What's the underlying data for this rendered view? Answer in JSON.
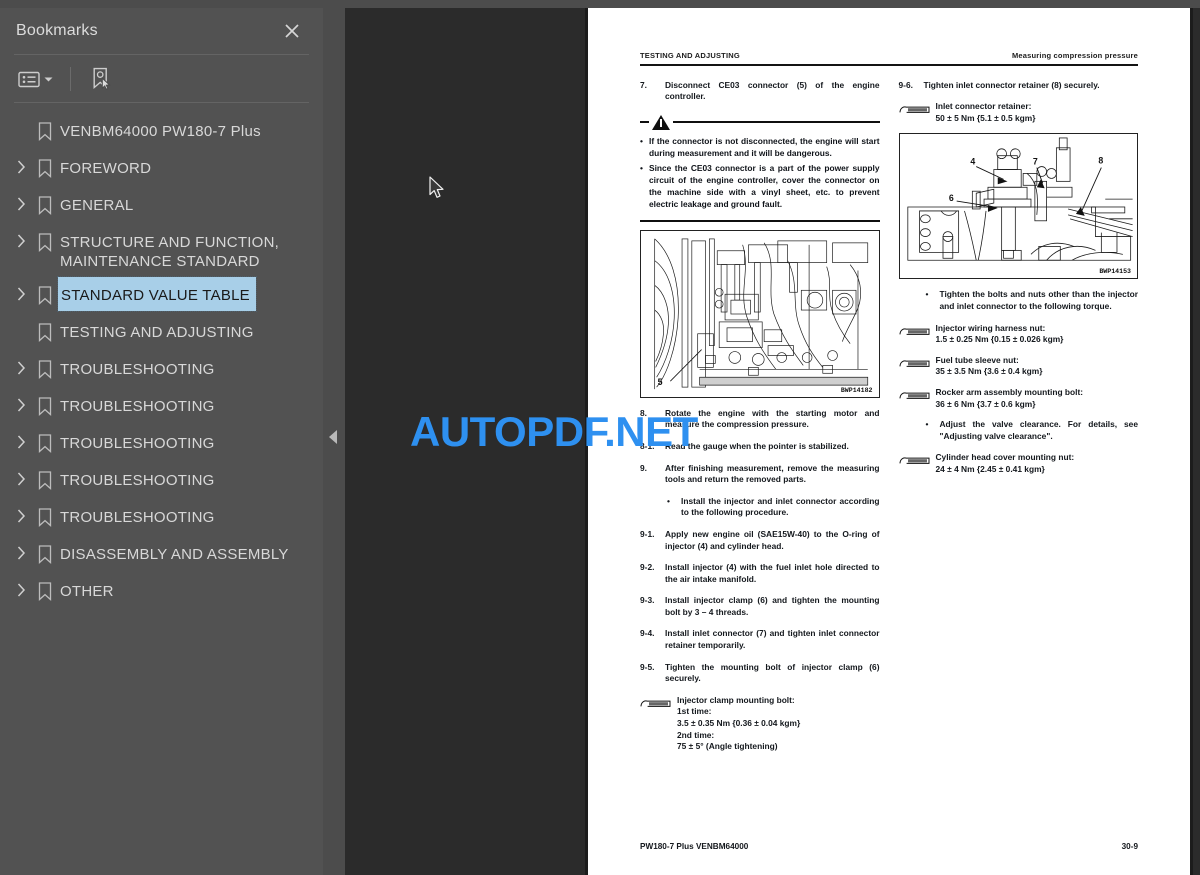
{
  "sidebar": {
    "title": "Bookmarks",
    "close_icon": "close-icon",
    "toolbar": {
      "list_options_icon": "list-options-icon",
      "dropdown_caret_icon": "chevron-down-icon",
      "new_bookmark_icon": "new-bookmark-icon"
    },
    "items": [
      {
        "label": "VENBM64000 PW180-7 Plus",
        "expandable": false,
        "selected": false
      },
      {
        "label": "FOREWORD",
        "expandable": true,
        "selected": false
      },
      {
        "label": "GENERAL",
        "expandable": true,
        "selected": false
      },
      {
        "label": "STRUCTURE AND FUNCTION, MAINTENANCE STANDARD",
        "expandable": true,
        "selected": false
      },
      {
        "label": "STANDARD VALUE TABLE",
        "expandable": true,
        "selected": true
      },
      {
        "label": "TESTING AND ADJUSTING",
        "expandable": false,
        "selected": false
      },
      {
        "label": "TROUBLESHOOTING",
        "expandable": true,
        "selected": false
      },
      {
        "label": "TROUBLESHOOTING",
        "expandable": true,
        "selected": false
      },
      {
        "label": "TROUBLESHOOTING",
        "expandable": true,
        "selected": false
      },
      {
        "label": "TROUBLESHOOTING",
        "expandable": true,
        "selected": false
      },
      {
        "label": "TROUBLESHOOTING",
        "expandable": true,
        "selected": false
      },
      {
        "label": "DISASSEMBLY AND ASSEMBLY",
        "expandable": true,
        "selected": false
      },
      {
        "label": "OTHER",
        "expandable": true,
        "selected": false
      }
    ]
  },
  "viewer": {
    "collapse_handle_icon": "collapse-left-icon",
    "watermark": "AUTOPDF.NET",
    "watermark_color": "#2e90f0",
    "cursor_icon": "mouse-pointer-icon"
  },
  "page": {
    "header_left": "TESTING AND ADJUSTING",
    "header_right": "Measuring compression pressure",
    "footer_left": "PW180-7 Plus  VENBM64000",
    "footer_right": "30-9",
    "left_column": {
      "step7_num": "7.",
      "step7_text": "Disconnect CE03 connector (5) of the engine controller.",
      "warning_bullets": [
        "If the connector is not disconnected, the engine will start during measurement and it will be dangerous.",
        "Since the CE03 connector is a part of the power supply circuit of the engine controller, cover the connector on the machine side with a vinyl sheet, etc. to prevent electric leakage and ground fault."
      ],
      "figure1_label": "5",
      "figure1_code": "BWP14182",
      "step8_num": "8.",
      "step8_text": "Rotate the engine with the starting motor and measure the compression pressure.",
      "step8_1_num": "8-1.",
      "step8_1_text": "Read the gauge when the pointer is stabilized.",
      "step9_num": "9.",
      "step9_text": "After finishing measurement, remove the measuring tools and return the removed parts.",
      "step9_bullet": "Install the injector and inlet connector according to the following procedure.",
      "step9_1_num": "9-1.",
      "step9_1_text": "Apply new engine oil (SAE15W-40) to the O-ring of injector (4) and cylinder head.",
      "step9_2_num": "9-2.",
      "step9_2_text": "Install injector (4) with the fuel inlet hole directed to the air intake manifold.",
      "step9_3_num": "9-3.",
      "step9_3_text": "Install injector clamp (6) and tighten the mounting bolt by 3 – 4 threads.",
      "step9_4_num": "9-4.",
      "step9_4_text": "Install inlet connector (7) and tighten inlet connector retainer temporarily.",
      "step9_5_num": "9-5.",
      "step9_5_text": "Tighten the mounting bolt of injector clamp (6) securely.",
      "spec_clamp": "Injector clamp mounting bolt:\n1st time:\n3.5 ± 0.35 Nm {0.36 ± 0.04 kgm}\n2nd time:\n75 ± 5° (Angle tightening)"
    },
    "right_column": {
      "step9_6_num": "9-6.",
      "step9_6_text": "Tighten inlet connector retainer (8) securely.",
      "spec_inlet": "Inlet connector retainer:\n50 ± 5 Nm {5.1 ± 0.5 kgm}",
      "figure2_labels": [
        "4",
        "6",
        "7",
        "8"
      ],
      "figure2_code": "BWP14153",
      "bullet_torque": "Tighten the bolts and nuts other than the injector and inlet connector to the following torque.",
      "spec_harness": "Injector wiring harness nut:\n1.5 ± 0.25 Nm {0.15 ± 0.026 kgm}",
      "spec_sleeve": "Fuel tube sleeve nut:\n35 ± 3.5 Nm {3.6 ± 0.4 kgm}",
      "spec_rocker": "Rocker arm assembly mounting bolt:\n36 ± 6 Nm {3.7 ± 0.6 kgm}",
      "bullet_valve": "Adjust the valve clearance. For details, see \"Adjusting valve clearance\".",
      "spec_cover": "Cylinder head cover mounting nut:\n24 ± 4 Nm {2.45 ± 0.41 kgm}"
    }
  }
}
